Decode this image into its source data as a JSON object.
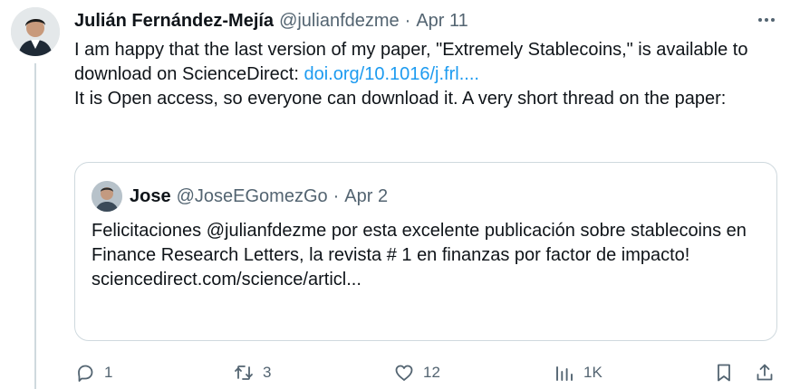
{
  "tweet": {
    "author_name": "Julián Fernández-Mejía",
    "author_handle": "@julianfdezme",
    "separator": "·",
    "date": "Apr 11",
    "text_line1_prefix": "I am happy that the last version of my paper, \"Extremely Stablecoins,\" is available to download on ScienceDirect: ",
    "link_text": "doi.org/10.1016/j.frl....",
    "text_line2": "It is Open access, so everyone can download it.  A very short thread on the paper:"
  },
  "quote": {
    "author_name": "Jose",
    "author_handle": "@JoseEGomezGo",
    "separator": "·",
    "date": "Apr 2",
    "text": "Felicitaciones @julianfdezme por esta excelente publicación sobre stablecoins en Finance Research Letters, la revista # 1 en finanzas por factor de impacto!",
    "link_text": "sciencedirect.com/science/articl..."
  },
  "actions": {
    "replies": "1",
    "retweets": "3",
    "likes": "12",
    "views": "1K"
  },
  "icons": {
    "more": "more-horizontal-icon",
    "reply": "reply-icon",
    "retweet": "retweet-icon",
    "like": "heart-icon",
    "views": "analytics-icon",
    "bookmark": "bookmark-icon",
    "share": "share-icon"
  },
  "colors": {
    "text": "#0f1419",
    "secondary": "#536471",
    "link": "#1d9bf0",
    "border": "#cfd9de"
  }
}
